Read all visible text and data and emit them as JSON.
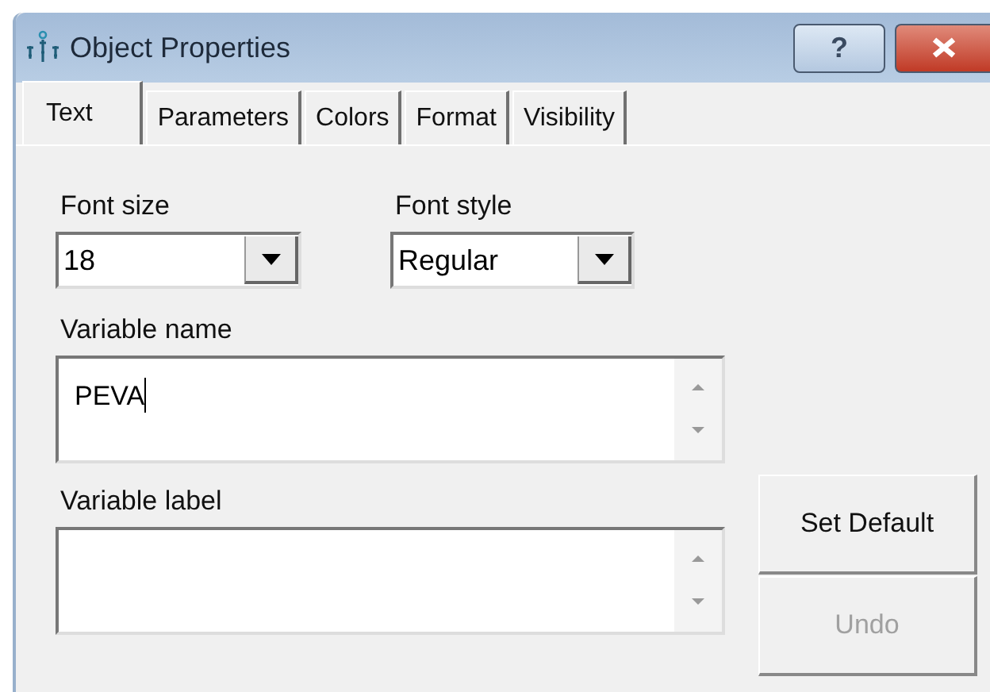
{
  "window": {
    "title": "Object Properties",
    "help_button": "?"
  },
  "tabs": [
    {
      "label": "Text",
      "selected": true
    },
    {
      "label": "Parameters",
      "selected": false
    },
    {
      "label": "Colors",
      "selected": false
    },
    {
      "label": "Format",
      "selected": false
    },
    {
      "label": "Visibility",
      "selected": false
    }
  ],
  "font_size": {
    "label": "Font size",
    "value": "18"
  },
  "font_style": {
    "label": "Font style",
    "value": "Regular"
  },
  "variable_name": {
    "label": "Variable name",
    "value": "PEVA"
  },
  "variable_label": {
    "label": "Variable label"
  },
  "buttons": [
    {
      "label": "Set Default",
      "disabled": false
    },
    {
      "label": "Undo",
      "disabled": true
    }
  ]
}
